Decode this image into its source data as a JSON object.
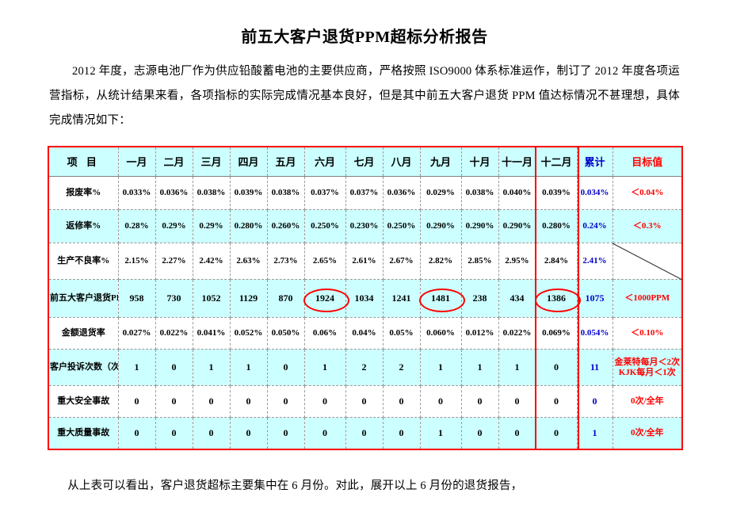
{
  "document": {
    "title": "前五大客户退货PPM超标分析报告",
    "intro": "2012 年度，志源电池厂作为供应铅酸蓄电池的主要供应商，严格按照 ISO9000 体系标准运作，制订了 2012 年度各项运营指标，从统计结果来看，各项指标的实际完成情况基本良好，但是其中前五大客户退货 PPM 值达标情况不甚理想，具体完成情况如下：",
    "closing": "从上表可以看出，客户退货超标主要集中在 6 月份。对此，展开以上 6 月份的退货报告，"
  },
  "colors": {
    "header_fill": "#ccffff",
    "accent_red": "#ff0000",
    "accent_blue": "#0000cc",
    "grid": "#999999"
  },
  "table": {
    "headers": [
      "项  目",
      "一月",
      "二月",
      "三月",
      "四月",
      "五月",
      "六月",
      "七月",
      "八月",
      "九月",
      "十月",
      "十一月",
      "十二月",
      "累计",
      "目标值"
    ],
    "highlight_column": "十二月",
    "rows": [
      {
        "label": "报废率%",
        "shade": "white",
        "values": [
          "0.033%",
          "0.036%",
          "0.038%",
          "0.039%",
          "0.038%",
          "0.037%",
          "0.037%",
          "0.036%",
          "0.029%",
          "0.038%",
          "0.040%",
          "0.039%"
        ],
        "total": "0.034%",
        "target": "＜0.04%"
      },
      {
        "label": "返修率%",
        "shade": "cyan",
        "values": [
          "0.28%",
          "0.29%",
          "0.29%",
          "0.280%",
          "0.260%",
          "0.250%",
          "0.230%",
          "0.250%",
          "0.290%",
          "0.290%",
          "0.290%",
          "0.280%"
        ],
        "total": "0.24%",
        "target": "＜0.3%"
      },
      {
        "label": "生产不良率%",
        "shade": "white",
        "values": [
          "2.15%",
          "2.27%",
          "2.42%",
          "2.63%",
          "2.73%",
          "2.65%",
          "2.61%",
          "2.67%",
          "2.82%",
          "2.85%",
          "2.95%",
          "2.84%"
        ],
        "total": "2.41%",
        "target": ""
      },
      {
        "label": "前五大客户退货PPM",
        "shade": "cyan",
        "values": [
          "958",
          "730",
          "1052",
          "1129",
          "870",
          "1924",
          "1034",
          "1241",
          "1481",
          "238",
          "434",
          "1386"
        ],
        "total": "1075",
        "target": "＜1000PPM"
      },
      {
        "label": "金额退货率",
        "shade": "white",
        "values": [
          "0.027%",
          "0.022%",
          "0.041%",
          "0.052%",
          "0.050%",
          "0.06%",
          "0.04%",
          "0.05%",
          "0.060%",
          "0.012%",
          "0.022%",
          "0.069%"
        ],
        "total": "0.054%",
        "target": "＜0.10%"
      },
      {
        "label": "客户投诉次数（次）",
        "shade": "cyan",
        "values": [
          "1",
          "0",
          "1",
          "1",
          "0",
          "1",
          "2",
          "2",
          "1",
          "1",
          "1",
          "0"
        ],
        "total": "11",
        "target": "金莱特每月＜2次\nKJK每月＜1次"
      },
      {
        "label": "重大安全事故",
        "shade": "white",
        "values": [
          "0",
          "0",
          "0",
          "0",
          "0",
          "0",
          "0",
          "0",
          "0",
          "0",
          "0",
          "0"
        ],
        "total": "0",
        "target": "0次/全年"
      },
      {
        "label": "重大质量事故",
        "shade": "cyan",
        "values": [
          "0",
          "0",
          "0",
          "0",
          "0",
          "0",
          "0",
          "0",
          "1",
          "0",
          "0",
          "0"
        ],
        "total": "1",
        "target": "0次/全年"
      }
    ],
    "circled_cells": [
      {
        "row": "前五大客户退货PPM",
        "column": "六月",
        "value": "1924"
      },
      {
        "row": "前五大客户退货PPM",
        "column": "九月",
        "value": "1481"
      },
      {
        "row": "前五大客户退货PPM",
        "column": "十二月",
        "value": "1386"
      }
    ]
  }
}
